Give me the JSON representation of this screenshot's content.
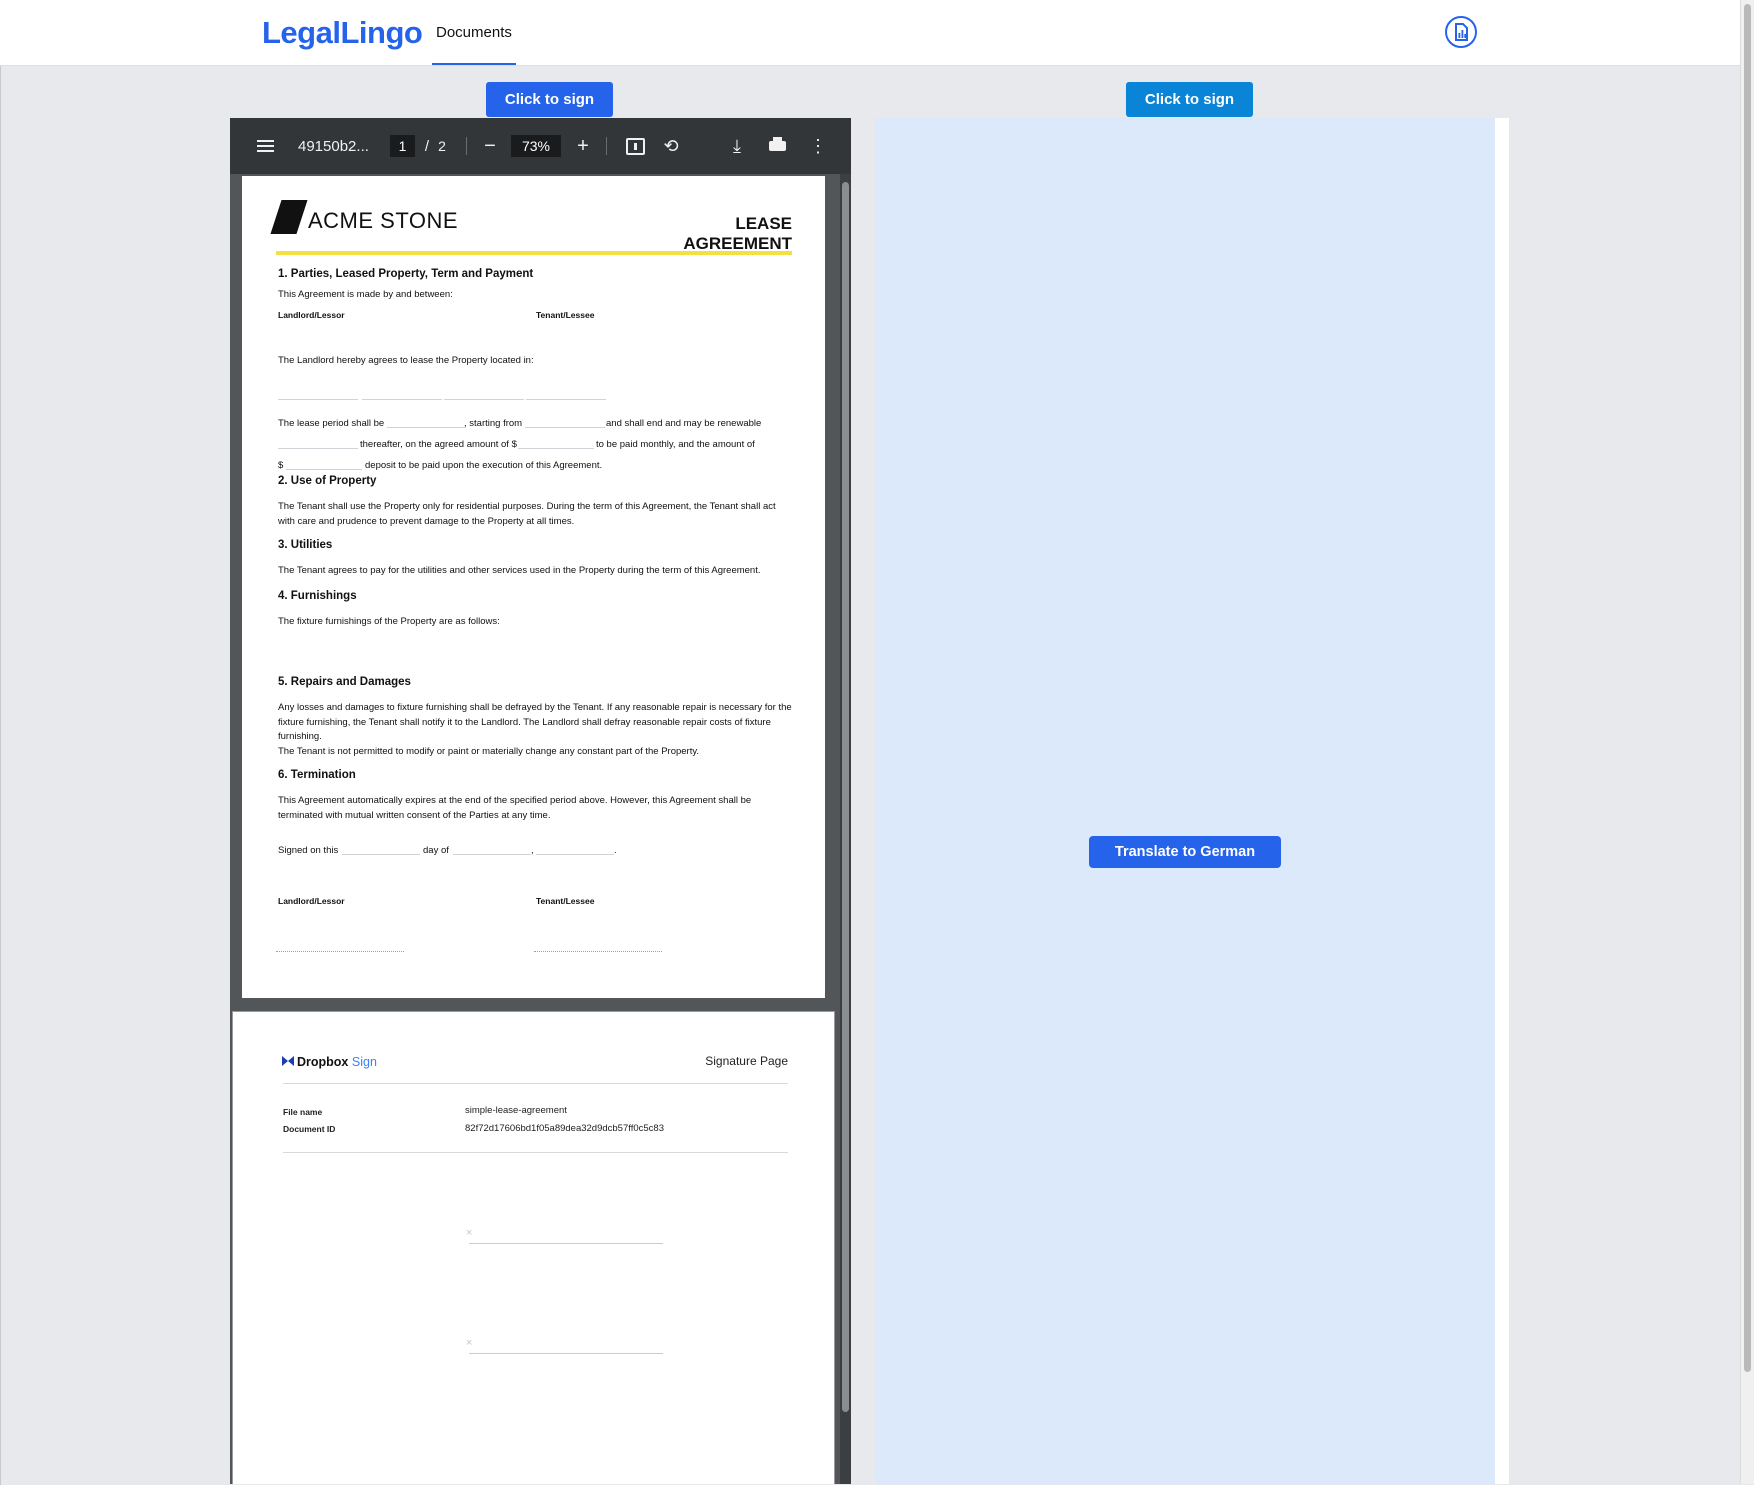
{
  "header": {
    "brand": "LegalLingo",
    "nav_tab": "Documents",
    "app_icon": "document-chart-icon"
  },
  "actions": {
    "sign_left": "Click to sign",
    "sign_right": "Click to sign",
    "translate": "Translate to German"
  },
  "viewer": {
    "file_title": "49150b2...",
    "current_page": "1",
    "page_sep": "/",
    "total_pages": "2",
    "zoom": "73%",
    "icons": [
      "menu-icon",
      "zoom-out-icon",
      "zoom-in-icon",
      "fit-page-icon",
      "rotate-icon",
      "download-icon",
      "print-icon",
      "more-options-icon"
    ]
  },
  "page1": {
    "company": "ACME STONE",
    "doc_title": "LEASE AGREEMENT",
    "s1_heading": "1. Parties, Leased Property, Term and Payment",
    "s1_intro": "This Agreement is made by and between:",
    "landlord_label": "Landlord/Lessor",
    "tenant_label": "Tenant/Lessee",
    "s1_property": "The Landlord hereby agrees to lease the Property located in:",
    "s1_term_a": "The lease period shall be",
    "s1_term_b": ", starting from",
    "s1_term_c": "and shall end and may be renewable",
    "s1_term_d": "thereafter, on the agreed amount of $",
    "s1_term_e": "to be paid monthly, and the amount of",
    "s1_term_f": "$",
    "s1_term_g": "deposit to be paid upon the execution of this Agreement.",
    "s2_heading": "2. Use of Property",
    "s2_line1": "The Tenant shall use the Property only for residential purposes. During the term of this Agreement, the Tenant shall act",
    "s2_line2": "with care and prudence to prevent damage to the Property at all times.",
    "s3_heading": "3. Utilities",
    "s3_line1": "The Tenant agrees to pay for the utilities and other services used in the Property during the term of this Agreement.",
    "s4_heading": "4. Furnishings",
    "s4_line1": "The fixture furnishings of the Property are as follows:",
    "s5_heading": "5. Repairs and Damages",
    "s5_line1": "Any losses and damages to fixture furnishing shall be defrayed by the Tenant. If any reasonable repair is necessary for the",
    "s5_line2": "fixture furnishing, the Tenant shall notify it to the Landlord. The Landlord shall defray reasonable repair costs of fixture",
    "s5_line3": "furnishing.",
    "s5_line4": "The Tenant is not permitted to modify or paint or materially change any constant part of the Property.",
    "s6_heading": "6. Termination",
    "s6_line1": "This Agreement automatically expires at the end of the specified period above. However, this Agreement shall be",
    "s6_line2": "terminated with mutual written consent of the Parties at any time.",
    "signed_a": "Signed on this",
    "signed_b": "day of",
    "signed_c": ",",
    "signed_d": "."
  },
  "page2": {
    "brand_a": "Dropbox",
    "brand_b": "Sign",
    "title": "Signature Page",
    "file_name_label": "File name",
    "file_name_value": "simple-lease-agreement",
    "doc_id_label": "Document ID",
    "doc_id_value": "82f72d17606bd1f05a89dea32d9dcb57ff0c5c83",
    "sig_mark": "×"
  }
}
